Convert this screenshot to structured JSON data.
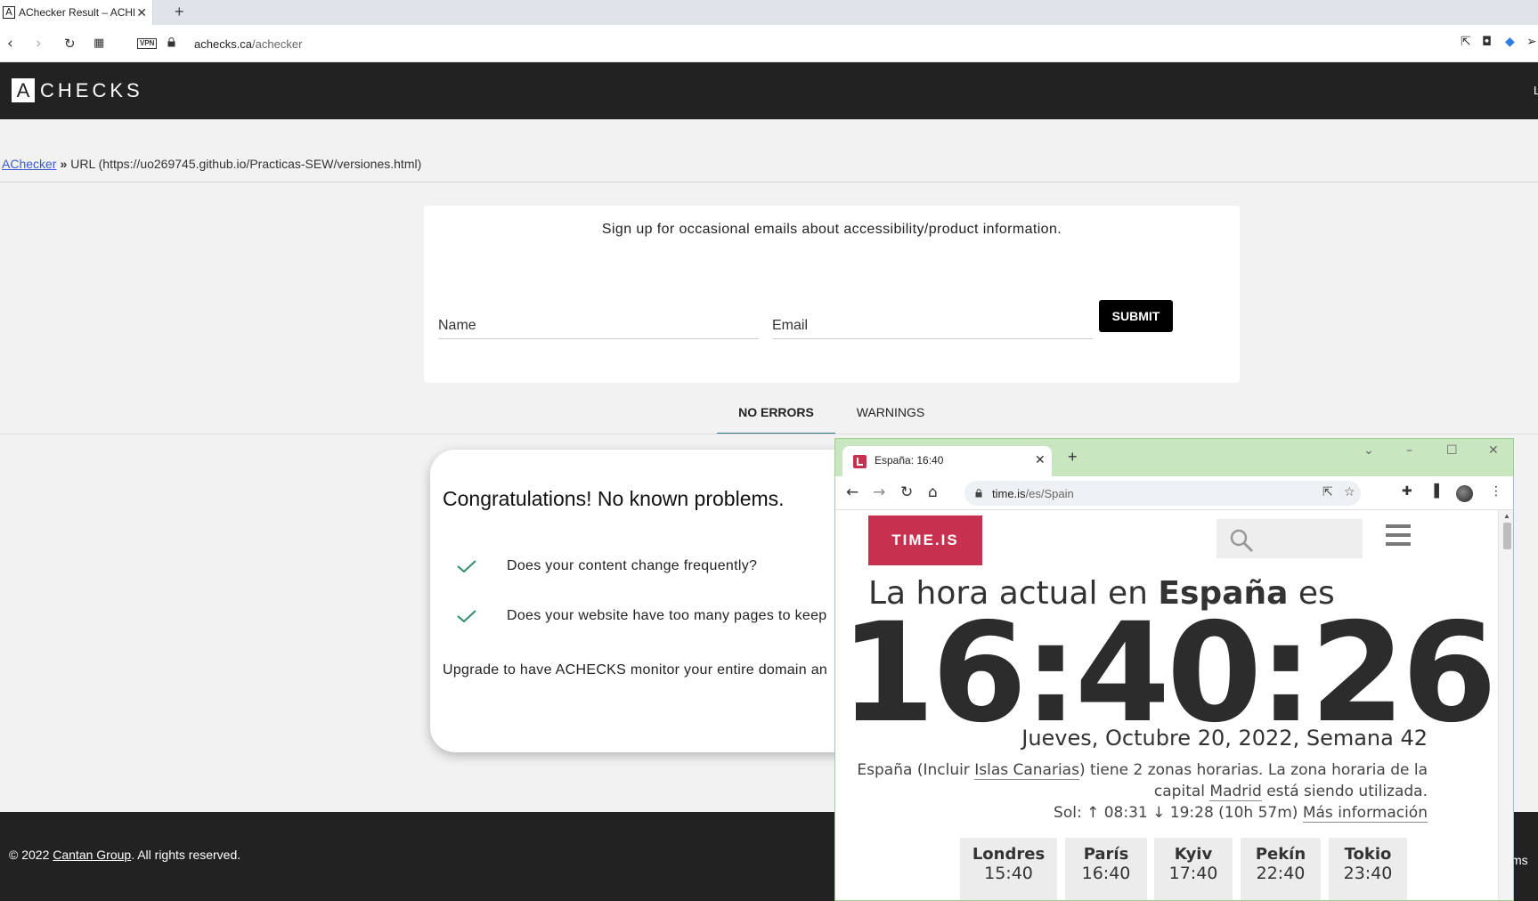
{
  "browser": {
    "tab_favicon": "A",
    "tab_title": "AChecker Result – ACHECKS",
    "url_domain": "achecks.ca",
    "url_path": "/achecker",
    "vpn_label": "VPN"
  },
  "site": {
    "logo_letter": "A",
    "logo_text": "CHECKS",
    "header_right": "L",
    "breadcrumb_link": "AChecker",
    "breadcrumb_current": "URL (https://uo269745.github.io/Practicas-SEW/versiones.html)",
    "signup_text": "Sign up for occasional emails about accessibility/product information.",
    "name_placeholder": "Name",
    "email_placeholder": "Email",
    "submit_label": "SUBMIT",
    "tab_no_errors": "NO ERRORS",
    "tab_warnings": "WARNINGS",
    "card_title": "Congratulations! No known problems.",
    "check_items": [
      "Does your content change frequently?",
      "Does your website have too many pages to keep"
    ],
    "upgrade_text": "Upgrade to have ACHECKS monitor your entire domain an",
    "footer_prefix": "© 2022 ",
    "footer_link": "Cantan Group",
    "footer_suffix": ". All rights reserved.",
    "footer_right": "ms"
  },
  "overlay": {
    "tab_title": "España: 16:40",
    "url_domain": "time.is",
    "url_path": "/es/Spain",
    "logo": "TIME.IS",
    "heading_prefix": "La hora actual en ",
    "heading_country": "España",
    "heading_suffix": " es",
    "clock": "16:40:26",
    "date": "Jueves, Octubre 20, 2022, Semana 42",
    "info_1a": "España (Incluir ",
    "info_1b": "Islas Canarias",
    "info_1c": ") tiene 2 zonas horarias. La zona horaria de la",
    "info_2a": "capital ",
    "info_2b": "Madrid",
    "info_2c": " está siendo utilizada.",
    "sun_text": "Sol: ↑ 08:31 ↓ 19:28 (10h 57m) ",
    "sun_link": "Más información",
    "cities": [
      {
        "name": "Londres",
        "time": "15:40"
      },
      {
        "name": "París",
        "time": "16:40"
      },
      {
        "name": "Kyiv",
        "time": "17:40"
      },
      {
        "name": "Pekín",
        "time": "22:40"
      },
      {
        "name": "Tokio",
        "time": "23:40"
      }
    ]
  }
}
